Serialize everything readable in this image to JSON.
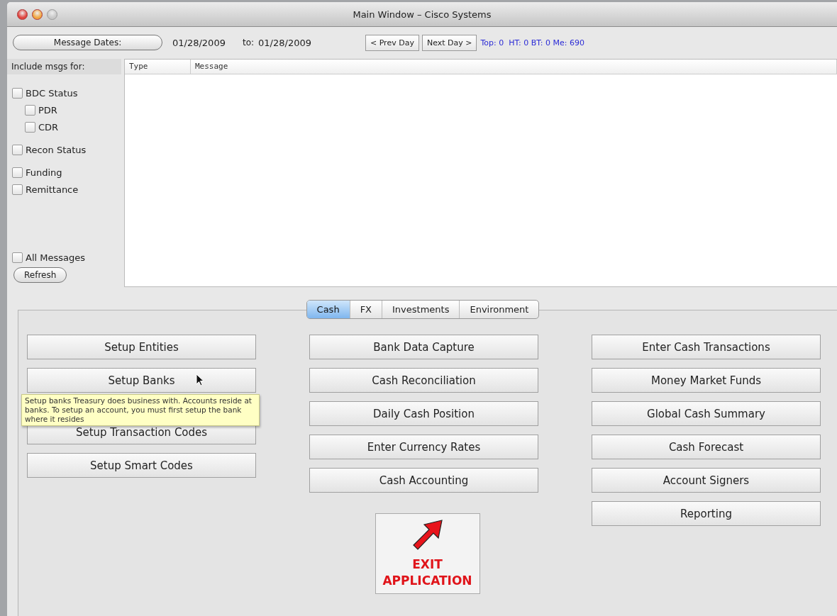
{
  "window": {
    "title": "Main Window – Cisco Systems"
  },
  "date_bar": {
    "dates_button": "Message Dates:",
    "from_date": "01/28/2009",
    "to_label": "to:",
    "to_date": "01/28/2009",
    "prev_button": "< Prev Day",
    "next_button": "Next Day >",
    "stats": "Top: 0  HT: 0 BT: 0 Me: 690"
  },
  "filters": {
    "label": "Include msgs for:",
    "groups": [
      {
        "items": [
          {
            "label": "BDC Status",
            "checked": false,
            "children": [
              {
                "label": "PDR",
                "checked": false
              },
              {
                "label": "CDR",
                "checked": false
              }
            ]
          }
        ]
      },
      {
        "items": [
          {
            "label": "Recon Status",
            "checked": false
          }
        ]
      },
      {
        "items": [
          {
            "label": "Funding",
            "checked": false
          },
          {
            "label": "Remittance",
            "checked": false
          }
        ]
      },
      {
        "items": [
          {
            "label": "All Messages",
            "checked": false
          }
        ]
      }
    ],
    "refresh_button": "Refresh"
  },
  "table": {
    "columns": [
      "Type",
      "Message"
    ]
  },
  "tabs": [
    {
      "label": "Cash",
      "selected": true
    },
    {
      "label": "FX",
      "selected": false
    },
    {
      "label": "Investments",
      "selected": false
    },
    {
      "label": "Environment",
      "selected": false
    }
  ],
  "button_columns": [
    [
      "Setup Entities",
      "Setup Banks",
      "Setup Transaction Codes",
      "Setup Smart Codes"
    ],
    [
      "Bank Data Capture",
      "Cash Reconciliation",
      "Daily Cash Position",
      "Enter Currency Rates",
      "Cash Accounting"
    ],
    [
      "Enter Cash Transactions",
      "Money Market Funds",
      "Global Cash Summary",
      "Cash Forecast",
      "Account Signers",
      "Reporting"
    ]
  ],
  "exit_button": "EXIT APPLICATION",
  "tooltip": {
    "text": "Setup  banks Treasury does business with.  Accounts reside at banks.  To setup an account, you must first setup the bank where it resides"
  }
}
